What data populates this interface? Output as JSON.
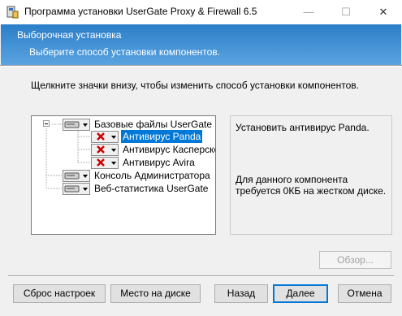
{
  "window": {
    "title": "Программа установки UserGate Proxy & Firewall 6.5",
    "controls": {
      "minimize": "—",
      "maximize": "☐",
      "close": "✕"
    }
  },
  "banner": {
    "title": "Выборочная установка",
    "subtitle": "Выберите способ установки компонентов.",
    "color": "#3a8ad6"
  },
  "instruction": "Щелкните значки внизу, чтобы изменить способ установки компонентов.",
  "tree": {
    "items": [
      {
        "label": "Базовые файлы UserGate Proxy & Firewall",
        "state": "install",
        "level": 0
      },
      {
        "label": "Антивирус Panda",
        "state": "not-installed",
        "level": 1,
        "selected": true
      },
      {
        "label": "Антивирус Касперского",
        "state": "not-installed",
        "level": 1
      },
      {
        "label": "Антивирус Avira",
        "state": "not-installed",
        "level": 1
      },
      {
        "label": "Консоль Администратора",
        "state": "install",
        "level": 0
      },
      {
        "label": "Веб-статистика UserGate",
        "state": "install",
        "level": 0
      }
    ],
    "selection_color": "#0078d7"
  },
  "description": {
    "text": "Установить антивирус Panda.",
    "size_note": "Для данного компонента требуется 0КБ на жестком диске."
  },
  "buttons": {
    "browse": "Обзор...",
    "reset": "Сброс настроек",
    "disk": "Место на диске",
    "back": "Назад",
    "next": "Далее",
    "cancel": "Отмена"
  }
}
